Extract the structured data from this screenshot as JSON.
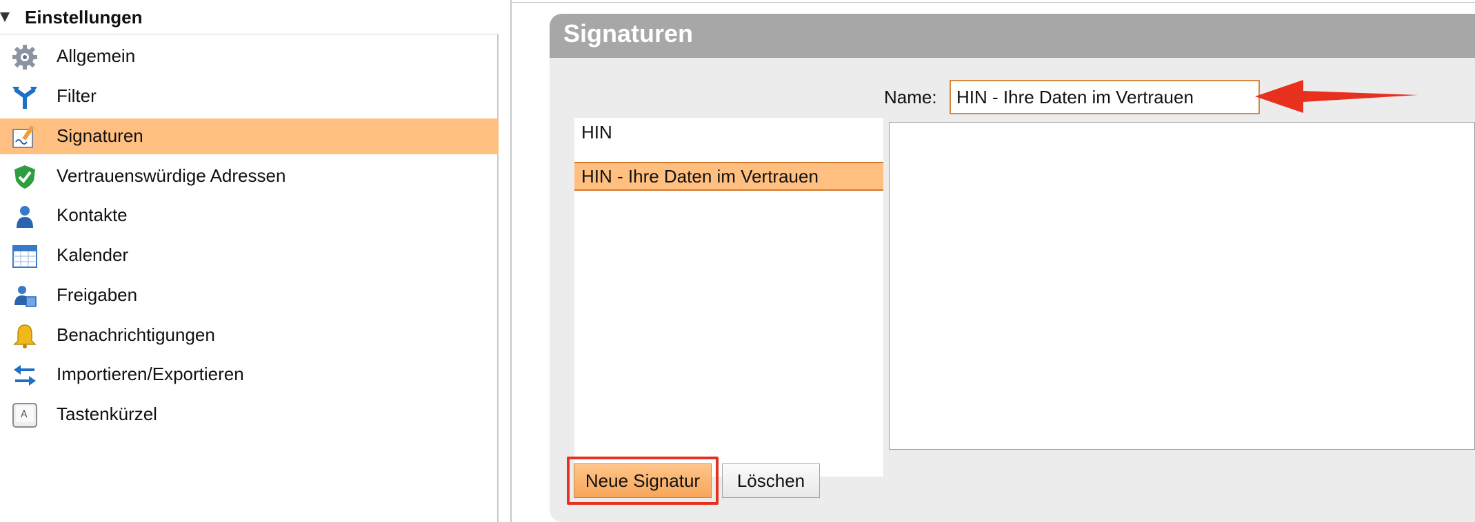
{
  "sidebar": {
    "header": "Einstellungen",
    "items": [
      {
        "label": "Allgemein",
        "icon": "gear-icon",
        "selected": false
      },
      {
        "label": "Filter",
        "icon": "filter-icon",
        "selected": false
      },
      {
        "label": "Signaturen",
        "icon": "signature-icon",
        "selected": true
      },
      {
        "label": "Vertrauenswürdige Adressen",
        "icon": "shield-check-icon",
        "selected": false
      },
      {
        "label": "Kontakte",
        "icon": "contact-icon",
        "selected": false
      },
      {
        "label": "Kalender",
        "icon": "calendar-icon",
        "selected": false
      },
      {
        "label": "Freigaben",
        "icon": "share-icon",
        "selected": false
      },
      {
        "label": "Benachrichtigungen",
        "icon": "bell-icon",
        "selected": false
      },
      {
        "label": "Importieren/Exportieren",
        "icon": "import-export-icon",
        "selected": false
      },
      {
        "label": "Tastenkürzel",
        "icon": "keyboard-key-icon",
        "selected": false
      }
    ]
  },
  "panel": {
    "title": "Signaturen",
    "name_label": "Name:",
    "name_value": "HIN - Ihre Daten im Vertrauen",
    "signatures": [
      {
        "label": "HIN",
        "selected": false
      },
      {
        "label": "HIN - Ihre Daten im Vertrauen",
        "selected": true
      }
    ],
    "new_button": "Neue Signatur",
    "delete_button": "Löschen"
  },
  "colors": {
    "selection": "#ffbf80",
    "header_gray": "#a7a7a7",
    "annotation_red": "#e8301e"
  }
}
